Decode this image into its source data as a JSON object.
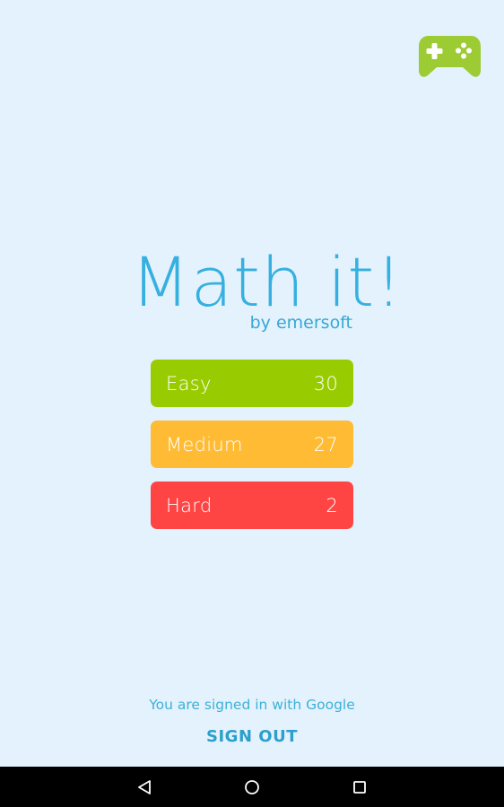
{
  "app": {
    "title": "Math it!",
    "subtitle": "by emersoft"
  },
  "toolbar": {
    "games_icon": "gamepad-icon",
    "games_icon_color": "#9ccb34"
  },
  "levels": [
    {
      "label": "Easy",
      "score": "30",
      "color": "#99cc00"
    },
    {
      "label": "Medium",
      "score": "27",
      "color": "#ffbb33"
    },
    {
      "label": "Hard",
      "score": "2",
      "color": "#ff4444"
    }
  ],
  "account": {
    "status": "You are signed in with Google",
    "sign_out_label": "SIGN OUT"
  },
  "navbar": {
    "back_icon": "back-icon",
    "home_icon": "home-icon",
    "recents_icon": "recents-icon"
  }
}
